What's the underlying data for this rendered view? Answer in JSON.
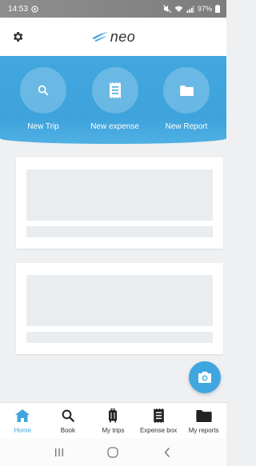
{
  "status_bar": {
    "time": "14:53",
    "battery": "97%"
  },
  "header": {
    "logo_text": "neo"
  },
  "actions": [
    {
      "label": "New Trip",
      "icon": "search-icon"
    },
    {
      "label": "New expense",
      "icon": "receipt-icon"
    },
    {
      "label": "New Report",
      "icon": "folder-icon"
    }
  ],
  "bottom_nav": [
    {
      "label": "Home",
      "icon": "home-icon",
      "active": true
    },
    {
      "label": "Book",
      "icon": "search-icon",
      "active": false
    },
    {
      "label": "My trips",
      "icon": "suitcase-icon",
      "active": false
    },
    {
      "label": "Expense box",
      "icon": "receipt-icon",
      "active": false
    },
    {
      "label": "My reports",
      "icon": "folder-icon",
      "active": false
    }
  ],
  "colors": {
    "accent": "#3fa6e0",
    "banner": "#43a7df",
    "placeholder": "#e9edf0"
  }
}
